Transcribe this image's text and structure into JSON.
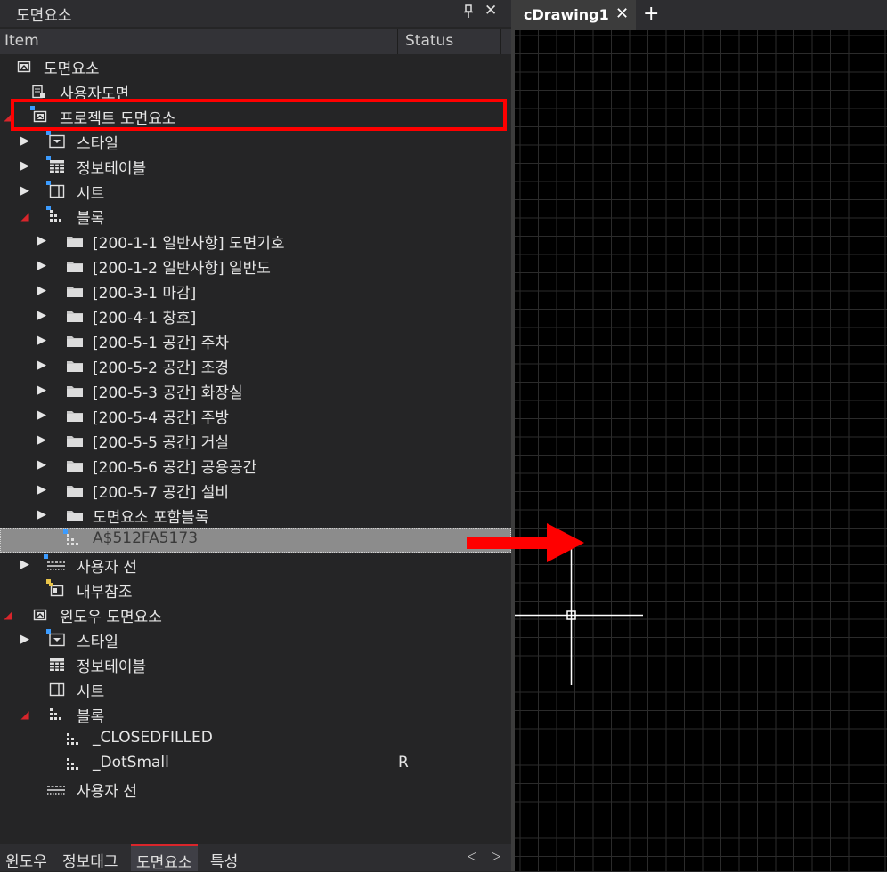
{
  "panel": {
    "title": "도면요소",
    "pin_icon": "pin-icon",
    "close_label": "✕",
    "columns": {
      "item": "Item",
      "status": "Status"
    }
  },
  "tree": [
    {
      "label": "도면요소",
      "icon": "drawing-elements-icon",
      "expander": "none",
      "status": ""
    },
    {
      "label": "사용자도면",
      "icon": "user-drawing-icon",
      "expander": "none",
      "status": ""
    },
    {
      "label": "프로젝트 도면요소",
      "icon": "drawing-elements-icon",
      "expander": "open",
      "status": ""
    },
    {
      "label": "스타일",
      "icon": "style-icon",
      "expander": "closed",
      "status": ""
    },
    {
      "label": "정보테이블",
      "icon": "table-icon",
      "expander": "closed",
      "status": ""
    },
    {
      "label": "시트",
      "icon": "sheet-icon",
      "expander": "closed",
      "status": ""
    },
    {
      "label": "블록",
      "icon": "block-icon",
      "expander": "open",
      "status": ""
    },
    {
      "label": "[200-1-1 일반사항] 도면기호",
      "icon": "folder-icon",
      "expander": "closed",
      "status": ""
    },
    {
      "label": "[200-1-2 일반사항] 일반도",
      "icon": "folder-icon",
      "expander": "closed",
      "status": ""
    },
    {
      "label": "[200-3-1 마감]",
      "icon": "folder-icon",
      "expander": "closed",
      "status": ""
    },
    {
      "label": "[200-4-1 창호]",
      "icon": "folder-icon",
      "expander": "closed",
      "status": ""
    },
    {
      "label": "[200-5-1 공간] 주차",
      "icon": "folder-icon",
      "expander": "closed",
      "status": ""
    },
    {
      "label": "[200-5-2 공간] 조경",
      "icon": "folder-icon",
      "expander": "closed",
      "status": ""
    },
    {
      "label": "[200-5-3 공간] 화장실",
      "icon": "folder-icon",
      "expander": "closed",
      "status": ""
    },
    {
      "label": "[200-5-4 공간] 주방",
      "icon": "folder-icon",
      "expander": "closed",
      "status": ""
    },
    {
      "label": "[200-5-5 공간] 거실",
      "icon": "folder-icon",
      "expander": "closed",
      "status": ""
    },
    {
      "label": "[200-5-6 공간] 공용공간",
      "icon": "folder-icon",
      "expander": "closed",
      "status": ""
    },
    {
      "label": "[200-5-7 공간] 설비",
      "icon": "folder-icon",
      "expander": "closed",
      "status": ""
    },
    {
      "label": "도면요소 포함블록",
      "icon": "folder-icon",
      "expander": "closed",
      "status": ""
    },
    {
      "label": "A$512FA5173",
      "icon": "block-icon",
      "expander": "none",
      "status": "",
      "selected": true
    },
    {
      "label": "사용자 선",
      "icon": "linetype-icon",
      "expander": "closed",
      "status": ""
    },
    {
      "label": "내부참조",
      "icon": "xref-icon",
      "expander": "none",
      "status": ""
    },
    {
      "label": "윈도우 도면요소",
      "icon": "drawing-elements-icon",
      "expander": "open",
      "status": ""
    },
    {
      "label": "스타일",
      "icon": "style-icon",
      "expander": "closed",
      "status": ""
    },
    {
      "label": "정보테이블",
      "icon": "table-icon",
      "expander": "none",
      "status": ""
    },
    {
      "label": "시트",
      "icon": "sheet-icon",
      "expander": "none",
      "status": ""
    },
    {
      "label": "블록",
      "icon": "block-icon",
      "expander": "open",
      "status": ""
    },
    {
      "label": "_CLOSEDFILLED",
      "icon": "block-icon",
      "expander": "none",
      "status": ""
    },
    {
      "label": "_DotSmall",
      "icon": "block-icon",
      "expander": "none",
      "status": "R"
    },
    {
      "label": "사용자 선",
      "icon": "linetype-icon",
      "expander": "none",
      "status": ""
    }
  ],
  "bottom_tabs": [
    "윈도우",
    "정보태그",
    "도면요소",
    "특성"
  ],
  "bottom_active": "도면요소",
  "nav": {
    "prev": "◁",
    "next": "▷"
  },
  "document": {
    "tab_label": "cDrawing1",
    "close_label": "✕",
    "add_label": "+"
  },
  "colors": {
    "accent_red": "#ff0000",
    "panel_bg": "#252526",
    "canvas_bg": "#000000",
    "selection": "#8c8c8c"
  }
}
